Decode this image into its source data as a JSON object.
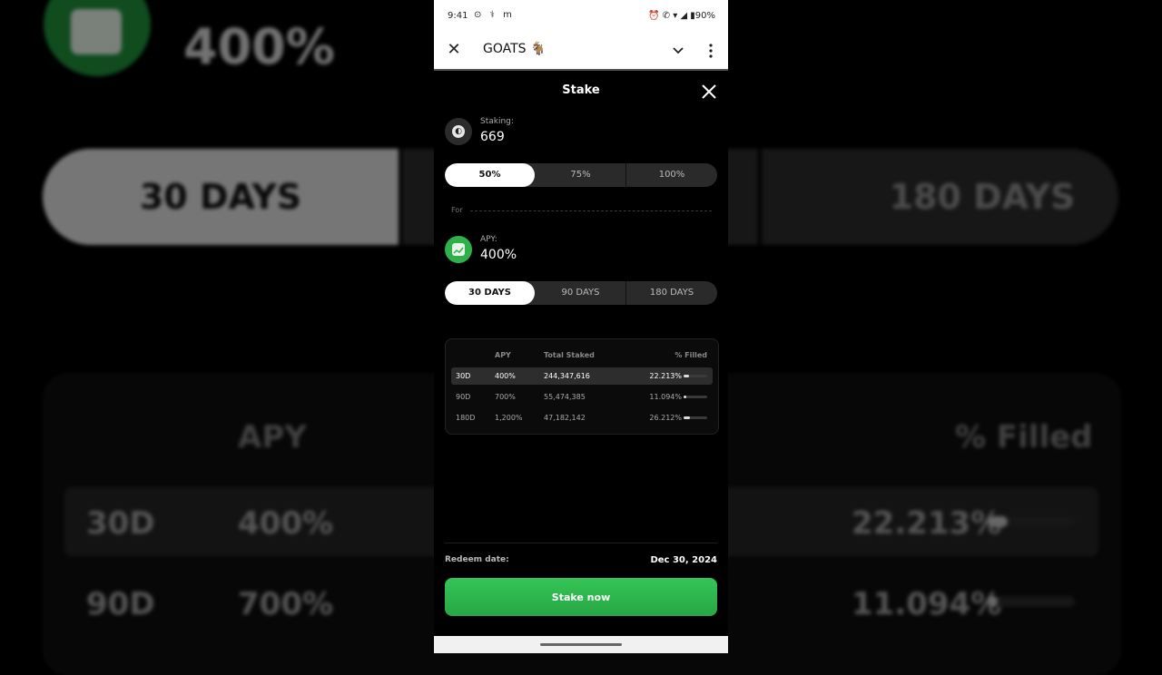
{
  "status_bar": {
    "time": "9:41",
    "left_icons": "⊙ ⚕ m",
    "right_text": "⏰ ✆ ▾ ◢ ▮90%"
  },
  "app_bar": {
    "title": "GOATS 🐐"
  },
  "sheet": {
    "title": "Stake",
    "staking_label": "Staking:",
    "staking_value": "669",
    "percent_options": [
      {
        "label": "50%",
        "active": true
      },
      {
        "label": "75%",
        "active": false
      },
      {
        "label": "100%",
        "active": false
      }
    ],
    "for_label": "For",
    "apy_label": "APY:",
    "apy_value": "400%",
    "period_options": [
      {
        "label": "30 DAYS",
        "active": true
      },
      {
        "label": "90 DAYS",
        "active": false
      },
      {
        "label": "180 DAYS",
        "active": false
      }
    ],
    "table": {
      "headers": [
        "APY",
        "Total Staked",
        "% Filled"
      ],
      "rows": [
        {
          "period": "30D",
          "apy": "400%",
          "total": "244,347,616",
          "filled": "22.213%",
          "fill_fraction": 0.22213,
          "highlight": true
        },
        {
          "period": "90D",
          "apy": "700%",
          "total": "55,474,385",
          "filled": "11.094%",
          "fill_fraction": 0.11094,
          "highlight": false
        },
        {
          "period": "180D",
          "apy": "1,200%",
          "total": "47,182,142",
          "filled": "26.212%",
          "fill_fraction": 0.26212,
          "highlight": false
        }
      ]
    },
    "redeem_label": "Redeem date:",
    "redeem_value": "Dec 30, 2024",
    "stake_button": "Stake now"
  },
  "background": {
    "apy": "400%",
    "tab_active": "30 DAYS",
    "tab_right": "180 DAYS",
    "h_apy": "APY",
    "h_filled": "% Filled",
    "row1": {
      "period": "30D",
      "apy": "400%",
      "filled": "22.213%"
    },
    "row2": {
      "period": "90D",
      "apy": "700%",
      "filled": "11.094%"
    }
  },
  "colors": {
    "accent_green": "#2fb14a",
    "button_green": "#35c457"
  }
}
